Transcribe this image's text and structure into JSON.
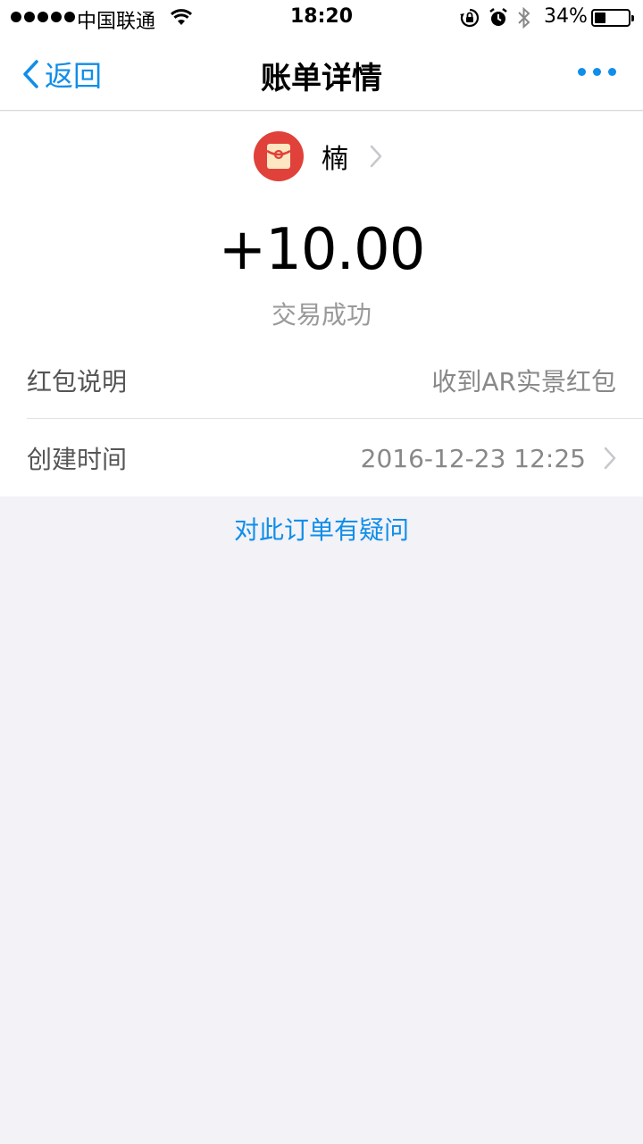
{
  "statusbar": {
    "carrier": "中国联通",
    "time": "18:20",
    "battery_percent": "34%",
    "battery_level": 0.34,
    "icons": [
      "signal-dots-icon",
      "wifi-icon",
      "rotation-lock-icon",
      "alarm-icon",
      "bluetooth-icon",
      "battery-icon"
    ]
  },
  "nav": {
    "back_label": "返回",
    "title": "账单详情",
    "more_icon": "more-dots-icon"
  },
  "payee": {
    "name": "楠",
    "avatar_icon": "red-envelope-icon"
  },
  "transaction": {
    "amount": "+10.00",
    "status": "交易成功"
  },
  "details": {
    "description_label": "红包说明",
    "description_value": "收到AR实景红包",
    "created_label": "创建时间",
    "created_value": "2016-12-23 12:25"
  },
  "footer": {
    "question_link": "对此订单有疑问"
  },
  "colors": {
    "accent": "#108ee9",
    "avatar_bg": "#e0413a",
    "page_bg": "#f2f2f7"
  }
}
